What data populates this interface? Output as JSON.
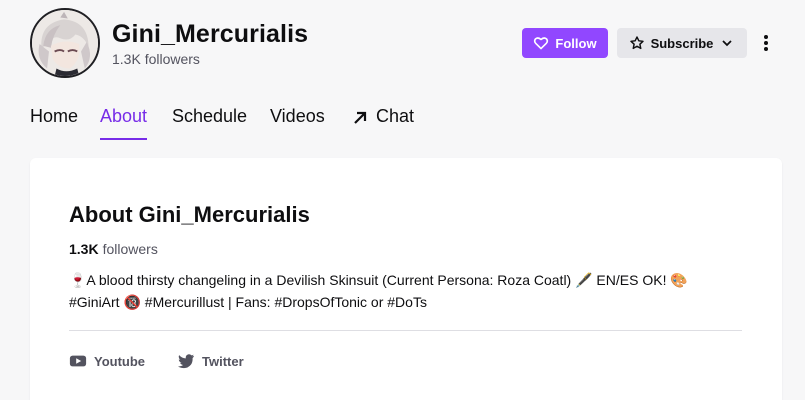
{
  "channel": {
    "name": "Gini_Mercurialis",
    "followers_text": "1.3K followers"
  },
  "actions": {
    "follow_label": "Follow",
    "subscribe_label": "Subscribe"
  },
  "tabs": [
    {
      "label": "Home"
    },
    {
      "label": "About",
      "active": true
    },
    {
      "label": "Schedule"
    },
    {
      "label": "Videos"
    },
    {
      "label": "Chat"
    }
  ],
  "about": {
    "title": "About Gini_Mercurialis",
    "followers_count": "1.3K",
    "followers_label": "followers",
    "bio_line1": "🍷A blood thirsty changeling in a Devilish Skinsuit (Current Persona: Roza Coatl) 🖋️ EN/ES OK! 🎨",
    "bio_line2": "#GiniArt 🔞 #Mercurillust | Fans: #DropsOfTonic or #DoTs"
  },
  "social_links": [
    {
      "label": "Youtube",
      "icon": "youtube-icon"
    },
    {
      "label": "Twitter",
      "icon": "twitter-icon"
    }
  ],
  "colors": {
    "accent": "#9147ff",
    "active_tab": "#772ce8",
    "background": "#f7f7f8"
  }
}
